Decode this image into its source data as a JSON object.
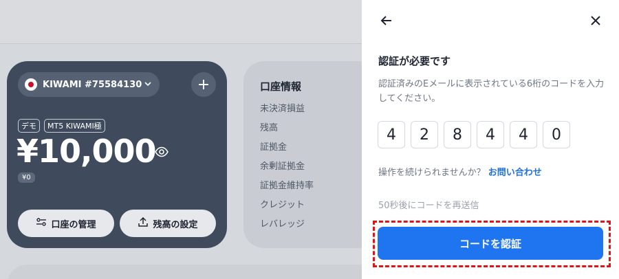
{
  "dashboard": {
    "account_selector": {
      "label": "KIWAMI #75584130"
    },
    "tags": [
      "デモ",
      "MT5 KIWAMI極"
    ],
    "balance": "¥10,000",
    "sub_balance": "¥0",
    "buttons": {
      "manage": "口座の管理",
      "set_balance": "残高の設定"
    },
    "info": {
      "title": "口座情報",
      "items": [
        "未決済損益",
        "残高",
        "証拠金",
        "余剰証拠金",
        "証拠金維持率",
        "クレジット",
        "レバレッジ"
      ]
    }
  },
  "panel": {
    "title": "認証が必要です",
    "description": "認証済みのEメールに表示されている6桁のコードを入力してください。",
    "code_digits": [
      "4",
      "2",
      "8",
      "4",
      "4",
      "0"
    ],
    "help_text": "操作を続けられませんか？",
    "help_link": "お問い合わせ",
    "resend_text": "50秒後にコードを再送信",
    "verify_button": "コードを認証"
  },
  "colors": {
    "accent": "#1f74ef",
    "card_dark": "#3f4b5c",
    "highlight": "#e01414"
  }
}
